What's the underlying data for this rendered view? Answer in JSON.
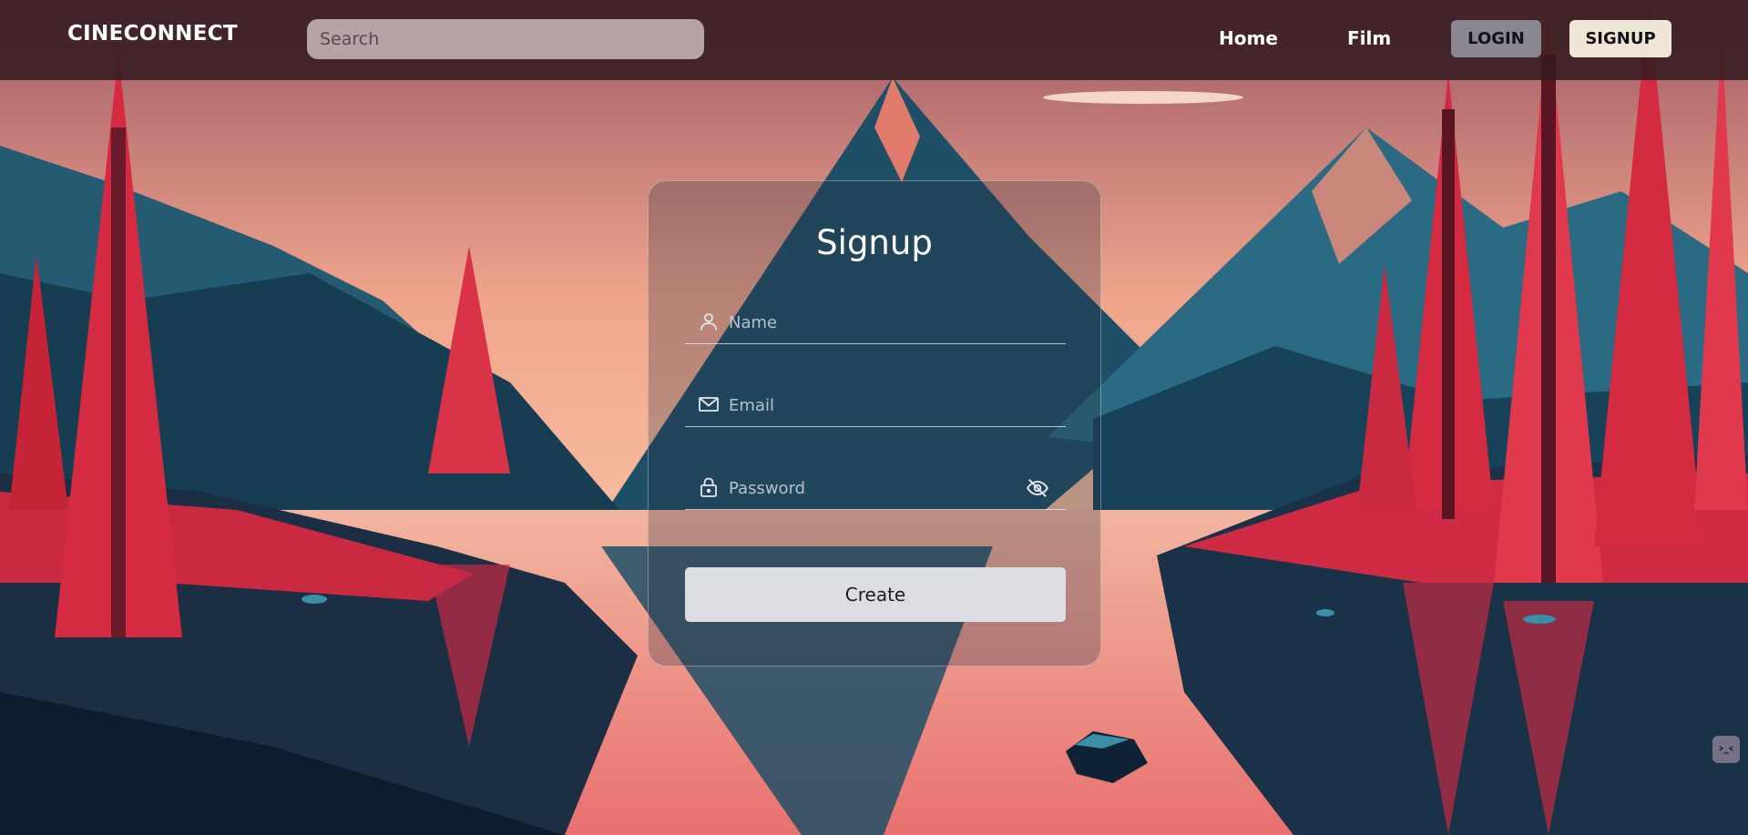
{
  "navbar": {
    "brand": "CINECONNECT",
    "search": {
      "placeholder": "Search",
      "value": ""
    },
    "links": {
      "home": "Home",
      "film": "Film"
    },
    "login_label": "LOGIN",
    "signup_label": "SIGNUP"
  },
  "form": {
    "title": "Signup",
    "name": {
      "placeholder": "Name",
      "value": "",
      "icon": "user-icon"
    },
    "email": {
      "placeholder": "Email",
      "value": "",
      "icon": "mail-icon"
    },
    "password": {
      "placeholder": "Password",
      "value": "",
      "icon": "lock-icon",
      "toggle_icon": "eye-off-icon"
    },
    "submit_label": "Create"
  },
  "background": {
    "icon": "mountain-lake-landscape-icon",
    "colors": {
      "sky_top": "#9e5a66",
      "sky_horizon": "#f7c0a2",
      "mountains": "#1c4a5f",
      "trees": "#d1263e",
      "water": "#f08a86"
    }
  },
  "corner_widget": {
    "icon": "cat-face-icon"
  },
  "colors": {
    "navbar": "#321a1e",
    "login_button": "#8b8790",
    "signup_button": "#efe6d6",
    "create_button": "#dcdde2"
  }
}
